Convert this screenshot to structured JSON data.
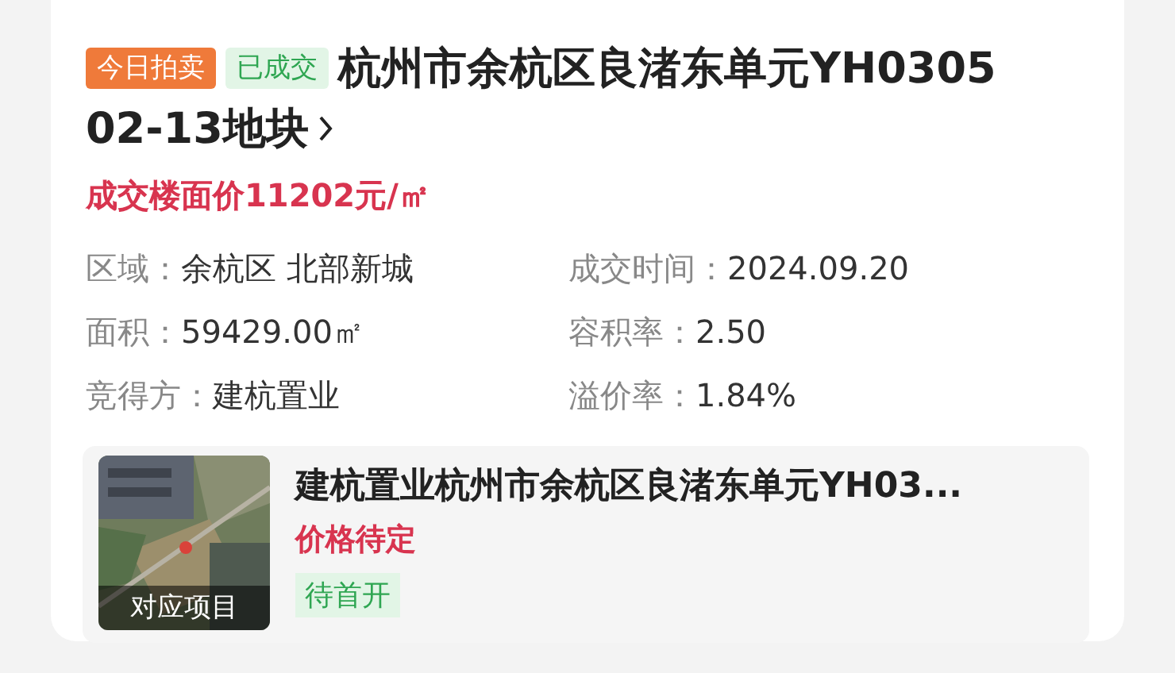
{
  "tags": [
    {
      "kind": "auction",
      "label": "今日拍卖"
    },
    {
      "kind": "status",
      "label": "已成交"
    }
  ],
  "title_lines": [
    "杭州市余杭区良渚东单元YH0305",
    "02-13地块"
  ],
  "price": "成交楼面价11202元/㎡",
  "info": [
    {
      "label": "区域：",
      "value": "余杭区 北部新城"
    },
    {
      "label": "成交时间：",
      "value": "2024.09.20"
    },
    {
      "label": "面积：",
      "value": "59429.00㎡"
    },
    {
      "label": "容积率：",
      "value": "2.50"
    },
    {
      "label": "竞得方：",
      "value": "建杭置业"
    },
    {
      "label": "溢价率：",
      "value": "1.84%"
    }
  ],
  "project": {
    "image_caption": "对应项目",
    "title": "建杭置业杭州市余杭区良渚东单元YH03...",
    "price": "价格待定",
    "status": "待首开"
  }
}
